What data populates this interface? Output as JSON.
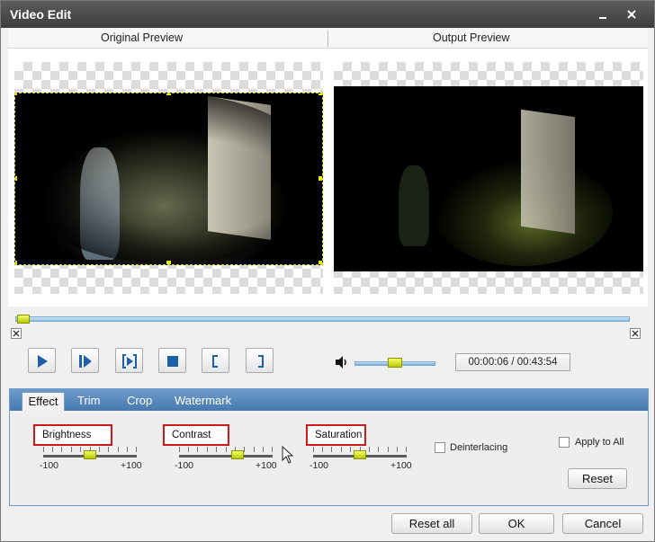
{
  "window": {
    "title": "Video Edit"
  },
  "preview": {
    "original_label": "Original Preview",
    "output_label": "Output Preview"
  },
  "playback": {
    "time_display": "00:00:06 / 00:43:54",
    "position_fraction": 0.002,
    "volume_fraction": 0.5
  },
  "tabs": [
    {
      "label": "Effect",
      "active": true
    },
    {
      "label": "Trim",
      "active": false
    },
    {
      "label": "Crop",
      "active": false
    },
    {
      "label": "Watermark",
      "active": false
    }
  ],
  "effect": {
    "brightness": {
      "label": "Brightness",
      "min": "-100",
      "max": "+100",
      "value": 0
    },
    "contrast": {
      "label": "Contrast",
      "min": "-100",
      "max": "+100",
      "value": 20
    },
    "saturation": {
      "label": "Saturation",
      "min": "-100",
      "max": "+100",
      "value": 0
    },
    "deinterlacing_label": "Deinterlacing",
    "apply_all_label": "Apply to All",
    "reset_label": "Reset"
  },
  "footer": {
    "reset_all_label": "Reset all",
    "ok_label": "OK",
    "cancel_label": "Cancel"
  },
  "colors": {
    "accent": "#4779ae",
    "highlight_box": "#cc1a1a",
    "thumb": "#d9e600"
  }
}
